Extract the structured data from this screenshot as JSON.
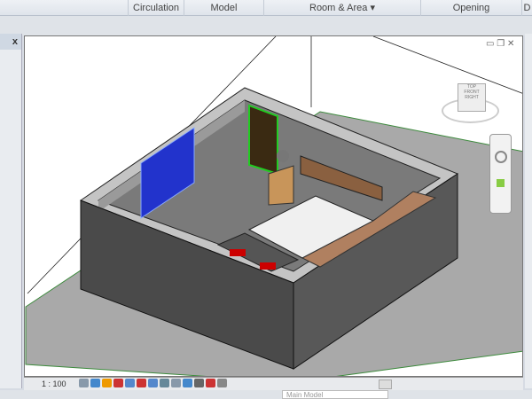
{
  "ribbon": {
    "panels": [
      {
        "label": "Circulation"
      },
      {
        "label": "Model"
      },
      {
        "label": "Room & Area ▾"
      },
      {
        "label": "Opening"
      },
      {
        "label": "D"
      }
    ]
  },
  "left_panel": {
    "close": "x"
  },
  "view": {
    "controls": {
      "minimize": "▭",
      "restore": "❐",
      "close": "✕"
    },
    "viewcube": {
      "top": "TOP",
      "front": "FRONT",
      "right": "RIGHT"
    }
  },
  "status": {
    "scale": "1 : 100"
  },
  "bottom": {
    "workset": "Main Model"
  }
}
